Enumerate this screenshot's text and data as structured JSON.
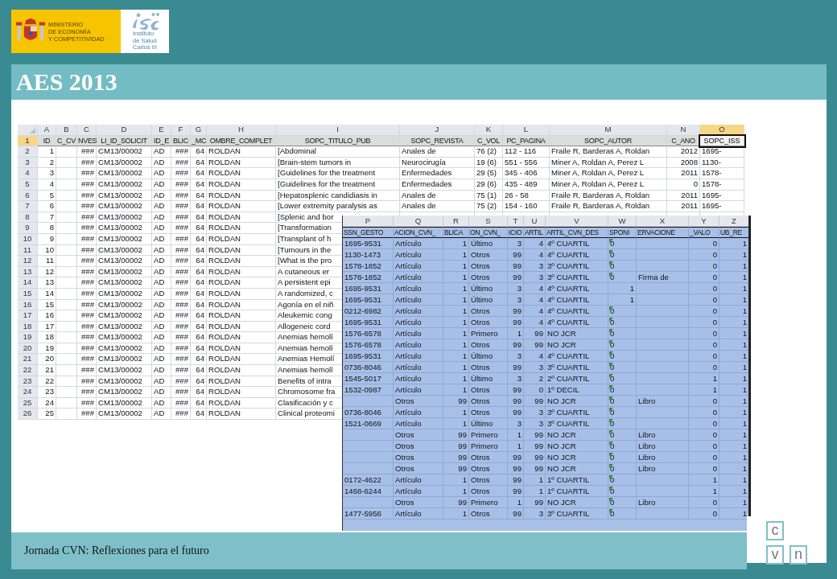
{
  "logos": {
    "ministry": [
      "MINISTERIO",
      "DE ECONOMÍA",
      "Y COMPETITIVIDAD"
    ],
    "institute": [
      "Instituto",
      "de Salud",
      "Carlos III"
    ]
  },
  "title": "AES 2013",
  "sheet_1": {
    "columns": [
      {
        "label": "A",
        "selected": false
      },
      {
        "label": "B",
        "selected": false
      },
      {
        "label": "C",
        "selected": false
      },
      {
        "label": "D",
        "selected": false
      },
      {
        "label": "E",
        "selected": false
      },
      {
        "label": "F",
        "selected": false
      },
      {
        "label": "G",
        "selected": false
      },
      {
        "label": "H",
        "selected": false
      },
      {
        "label": "I",
        "selected": false
      },
      {
        "label": "J",
        "selected": false
      },
      {
        "label": "K",
        "selected": false
      },
      {
        "label": "L",
        "selected": false
      },
      {
        "label": "M",
        "selected": false
      },
      {
        "label": "N",
        "selected": false
      },
      {
        "label": "O",
        "selected": true
      }
    ],
    "rows": [
      {
        "number": "1",
        "selected": true,
        "cells": [
          "ID",
          "C_CV",
          "NVES",
          "LI_ID_SOLICIT",
          "ID_E",
          "BLIC",
          "_MC",
          "OMBRE_COMPLET",
          "SOPC_TITULO_PUB",
          "SOPC_REVISTA",
          "C_VOL",
          "PC_PAGINA",
          "SOPC_AUTOR",
          "C_ANO",
          "SOPC_ISS"
        ]
      },
      {
        "number": "2",
        "selected": false,
        "cells": [
          "1",
          null,
          "###",
          "CM13/00002",
          "AD",
          "###",
          "64",
          "ROLDAN",
          "[Abdominal",
          "Anales de",
          "76 (2)",
          "112 - 116",
          "Fraile R, Barderas A, Roldan",
          "2012",
          "1695-"
        ]
      },
      {
        "number": "3",
        "selected": false,
        "cells": [
          "2",
          null,
          "###",
          "CM13/00002",
          "AD",
          "###",
          "64",
          "ROLDAN",
          "[Brain-stem tumors in",
          "Neurocirugía",
          "19 (6)",
          "551 - 556",
          "Miner A, Roldan A, Perez L",
          "2008",
          "1130-"
        ]
      },
      {
        "number": "4",
        "selected": false,
        "cells": [
          "3",
          null,
          "###",
          "CM13/00002",
          "AD",
          "###",
          "64",
          "ROLDAN",
          "[Guidelines for the treatment",
          "Enfermedades",
          "29 (5)",
          "345 - 406",
          "Miner A, Roldan A, Perez L",
          "2011",
          "1578-"
        ]
      },
      {
        "number": "5",
        "selected": false,
        "cells": [
          "4",
          null,
          "###",
          "CM13/00002",
          "AD",
          "###",
          "64",
          "ROLDAN",
          "[Guidelines for the treatment",
          "Enfermedades",
          "29 (6)",
          "435 - 489",
          "Miner A, Roldan A, Perez L",
          "0",
          "1578-"
        ]
      },
      {
        "number": "6",
        "selected": false,
        "cells": [
          "5",
          null,
          "###",
          "CM13/00002",
          "AD",
          "###",
          "64",
          "ROLDAN",
          "[Hepatosplenic candidiasis in",
          "Anales de",
          "75 (1)",
          "26 - 58",
          "Fraile R, Barderas A, Roldan",
          "2011",
          "1695-"
        ]
      },
      {
        "number": "7",
        "selected": false,
        "cells": [
          "6",
          null,
          "###",
          "CM13/00002",
          "AD",
          "###",
          "64",
          "ROLDAN",
          "[Lower extremity paralysis as",
          "Anales de",
          "75 (2)",
          "154 - 160",
          "Fraile R, Barderas A, Roldan",
          "2011",
          "1695-"
        ]
      },
      {
        "number": "8",
        "selected": false,
        "cells": [
          "7",
          null,
          "###",
          "CM13/00002",
          "AD",
          "###",
          "64",
          "ROLDAN",
          "[Splenic and bor"
        ]
      },
      {
        "number": "9",
        "selected": false,
        "cells": [
          "8",
          null,
          "###",
          "CM13/00002",
          "AD",
          "###",
          "64",
          "ROLDAN",
          "[Transformation"
        ]
      },
      {
        "number": "10",
        "selected": false,
        "cells": [
          "9",
          null,
          "###",
          "CM13/00002",
          "AD",
          "###",
          "64",
          "ROLDAN",
          "[Transplant of h"
        ]
      },
      {
        "number": "11",
        "selected": false,
        "cells": [
          "10",
          null,
          "###",
          "CM13/00002",
          "AD",
          "###",
          "64",
          "ROLDAN",
          "[Tumours in the"
        ]
      },
      {
        "number": "12",
        "selected": false,
        "cells": [
          "11",
          null,
          "###",
          "CM13/00002",
          "AD",
          "###",
          "64",
          "ROLDAN",
          "[What is the pro"
        ]
      },
      {
        "number": "13",
        "selected": false,
        "cells": [
          "12",
          null,
          "###",
          "CM13/00002",
          "AD",
          "###",
          "64",
          "ROLDAN",
          "A cutaneous er"
        ]
      },
      {
        "number": "14",
        "selected": false,
        "cells": [
          "13",
          null,
          "###",
          "CM13/00002",
          "AD",
          "###",
          "64",
          "ROLDAN",
          "A persistent epi"
        ]
      },
      {
        "number": "15",
        "selected": false,
        "cells": [
          "14",
          null,
          "###",
          "CM13/00002",
          "AD",
          "###",
          "64",
          "ROLDAN",
          "A randomized, c"
        ]
      },
      {
        "number": "16",
        "selected": false,
        "cells": [
          "15",
          null,
          "###",
          "CM13/00002",
          "AD",
          "###",
          "64",
          "ROLDAN",
          "Agonía en el niñ"
        ]
      },
      {
        "number": "17",
        "selected": false,
        "cells": [
          "16",
          null,
          "###",
          "CM13/00002",
          "AD",
          "###",
          "64",
          "ROLDAN",
          "Aleukemic cong"
        ]
      },
      {
        "number": "18",
        "selected": false,
        "cells": [
          "17",
          null,
          "###",
          "CM13/00002",
          "AD",
          "###",
          "64",
          "ROLDAN",
          "Allogeneic cord"
        ]
      },
      {
        "number": "19",
        "selected": false,
        "cells": [
          "18",
          null,
          "###",
          "CM13/00002",
          "AD",
          "###",
          "64",
          "ROLDAN",
          "Anemias hemolí"
        ]
      },
      {
        "number": "20",
        "selected": false,
        "cells": [
          "19",
          null,
          "###",
          "CM13/00002",
          "AD",
          "###",
          "64",
          "ROLDAN",
          "Anemias hemolí"
        ]
      },
      {
        "number": "21",
        "selected": false,
        "cells": [
          "20",
          null,
          "###",
          "CM13/00002",
          "AD",
          "###",
          "64",
          "ROLDAN",
          "Anemias Hemolí"
        ]
      },
      {
        "number": "22",
        "selected": false,
        "cells": [
          "21",
          null,
          "###",
          "CM13/00002",
          "AD",
          "###",
          "64",
          "ROLDAN",
          "Anemias hemolí"
        ]
      },
      {
        "number": "23",
        "selected": false,
        "cells": [
          "22",
          null,
          "###",
          "CM13/00002",
          "AD",
          "###",
          "64",
          "ROLDAN",
          "Benefits of intra"
        ]
      },
      {
        "number": "24",
        "selected": false,
        "cells": [
          "23",
          null,
          "###",
          "CM13/00002",
          "AD",
          "###",
          "64",
          "ROLDAN",
          "Chromosome fra"
        ]
      },
      {
        "number": "25",
        "selected": false,
        "cells": [
          "24",
          null,
          "###",
          "CM13/00002",
          "AD",
          "###",
          "64",
          "ROLDAN",
          "Clasificación y c"
        ]
      },
      {
        "number": "26",
        "selected": false,
        "cells": [
          "25",
          null,
          "###",
          "CM13/00002",
          "AD",
          "###",
          "64",
          "ROLDAN",
          "Clinical proteomi"
        ]
      }
    ]
  },
  "sheet_2": {
    "selected": true,
    "columns": [
      "P",
      "Q",
      "R",
      "S",
      "T",
      "U",
      "V",
      "W",
      "X",
      "Y",
      "Z"
    ],
    "header_cells": [
      "SSN_GESTO",
      "ACION_CVN_",
      "BLICA",
      "ON_CVN_",
      "ICIO",
      "ARTIL",
      "ARTIL_CVN_DES",
      "SPONI",
      "ERVACIONE",
      "_VALO",
      "UB_RE"
    ],
    "rows": [
      {
        "number_stored_as_text": true,
        "cells": [
          "1695-9531",
          "Artículo",
          "1",
          "Último",
          "3",
          "4",
          "4º CUARTIL",
          "0",
          null,
          "0",
          "1"
        ]
      },
      {
        "number_stored_as_text": true,
        "cells": [
          "1130-1473",
          "Artículo",
          "1",
          "Otros",
          "99",
          "4",
          "4º CUARTIL",
          "0",
          null,
          "0",
          "1"
        ]
      },
      {
        "number_stored_as_text": true,
        "cells": [
          "1578-1852",
          "Artículo",
          "1",
          "Otros",
          "99",
          "3",
          "3º CUARTIL",
          "0",
          null,
          "0",
          "1"
        ]
      },
      {
        "number_stored_as_text": true,
        "cells": [
          "1578-1852",
          "Artículo",
          "1",
          "Otros",
          "99",
          "3",
          "3º CUARTIL",
          "0",
          "Firma de",
          "0",
          "1"
        ]
      },
      {
        "number_stored_as_text": false,
        "cells": [
          "1695-9531",
          "Artículo",
          "1",
          "Último",
          "3",
          "4",
          "4º CUARTIL",
          "1",
          null,
          "0",
          "1"
        ]
      },
      {
        "number_stored_as_text": false,
        "cells": [
          "1695-9531",
          "Artículo",
          "1",
          "Último",
          "3",
          "4",
          "4º CUARTIL",
          "1",
          null,
          "0",
          "1"
        ]
      },
      {
        "number_stored_as_text": true,
        "cells": [
          "0212-6982",
          "Artículo",
          "1",
          "Otros",
          "99",
          "4",
          "4º CUARTIL",
          "0",
          null,
          "0",
          "1"
        ]
      },
      {
        "number_stored_as_text": true,
        "cells": [
          "1695-9531",
          "Artículo",
          "1",
          "Otros",
          "99",
          "4",
          "4º CUARTIL",
          "0",
          null,
          "0",
          "1"
        ]
      },
      {
        "number_stored_as_text": true,
        "cells": [
          "1576-6578",
          "Artículo",
          "1",
          "Primero",
          "1",
          "99",
          "NO JCR",
          "0",
          null,
          "0",
          "1"
        ]
      },
      {
        "number_stored_as_text": true,
        "cells": [
          "1576-6578",
          "Artículo",
          "1",
          "Otros",
          "99",
          "99",
          "NO JCR",
          "0",
          null,
          "0",
          "1"
        ]
      },
      {
        "number_stored_as_text": true,
        "cells": [
          "1695-9531",
          "Artículo",
          "1",
          "Último",
          "3",
          "4",
          "4º CUARTIL",
          "0",
          null,
          "0",
          "1"
        ]
      },
      {
        "number_stored_as_text": true,
        "cells": [
          "0736-8046",
          "Artículo",
          "1",
          "Otros",
          "99",
          "3",
          "3º CUARTIL",
          "0",
          null,
          "0",
          "1"
        ]
      },
      {
        "number_stored_as_text": true,
        "cells": [
          "1545-5017",
          "Artículo",
          "1",
          "Último",
          "3",
          "2",
          "2º CUARTIL",
          "0",
          null,
          "1",
          "1"
        ]
      },
      {
        "number_stored_as_text": true,
        "cells": [
          "1532-0987",
          "Artículo",
          "1",
          "Otros",
          "99",
          "0",
          "1º DECIL",
          "0",
          null,
          "1",
          "1"
        ]
      },
      {
        "number_stored_as_text": true,
        "cells": [
          null,
          "Otros",
          "99",
          "Otros",
          "99",
          "99",
          "NO JCR",
          "0",
          "Libro",
          "0",
          "1"
        ]
      },
      {
        "number_stored_as_text": true,
        "cells": [
          "0736-8046",
          "Artículo",
          "1",
          "Otros",
          "99",
          "3",
          "3º CUARTIL",
          "0",
          null,
          "0",
          "1"
        ]
      },
      {
        "number_stored_as_text": true,
        "cells": [
          "1521-0669",
          "Artículo",
          "1",
          "Último",
          "3",
          "3",
          "3º CUARTIL",
          "0",
          null,
          "0",
          "1"
        ]
      },
      {
        "number_stored_as_text": true,
        "cells": [
          null,
          "Otros",
          "99",
          "Primero",
          "1",
          "99",
          "NO JCR",
          "0",
          "Libro",
          "0",
          "1"
        ]
      },
      {
        "number_stored_as_text": true,
        "cells": [
          null,
          "Otros",
          "99",
          "Primero",
          "1",
          "99",
          "NO JCR",
          "0",
          "Libro",
          "0",
          "1"
        ]
      },
      {
        "number_stored_as_text": true,
        "cells": [
          null,
          "Otros",
          "99",
          "Otros",
          "99",
          "99",
          "NO JCR",
          "0",
          "Libro",
          "0",
          "1"
        ]
      },
      {
        "number_stored_as_text": true,
        "cells": [
          null,
          "Otros",
          "99",
          "Otros",
          "99",
          "99",
          "NO JCR",
          "0",
          "Libro",
          "0",
          "1"
        ]
      },
      {
        "number_stored_as_text": true,
        "cells": [
          "0172-4622",
          "Artículo",
          "1",
          "Otros",
          "99",
          "1",
          "1º CUARTIL",
          "0",
          null,
          "1",
          "1"
        ]
      },
      {
        "number_stored_as_text": true,
        "cells": [
          "1468-6244",
          "Artículo",
          "1",
          "Otros",
          "99",
          "1",
          "1º CUARTIL",
          "0",
          null,
          "1",
          "1"
        ]
      },
      {
        "number_stored_as_text": true,
        "cells": [
          null,
          "Otros",
          "99",
          "Primero",
          "1",
          "99",
          "NO JCR",
          "0",
          "Libro",
          "0",
          "1"
        ]
      },
      {
        "number_stored_as_text": true,
        "cells": [
          "1477-5956",
          "Artículo",
          "1",
          "Otros",
          "99",
          "3",
          "3º CUARTIL",
          "0",
          null,
          "0",
          "1"
        ]
      }
    ]
  },
  "footer": "Jornada CVN: Reflexiones para el futuro",
  "cvn_logo": [
    "c",
    "v",
    "n"
  ]
}
